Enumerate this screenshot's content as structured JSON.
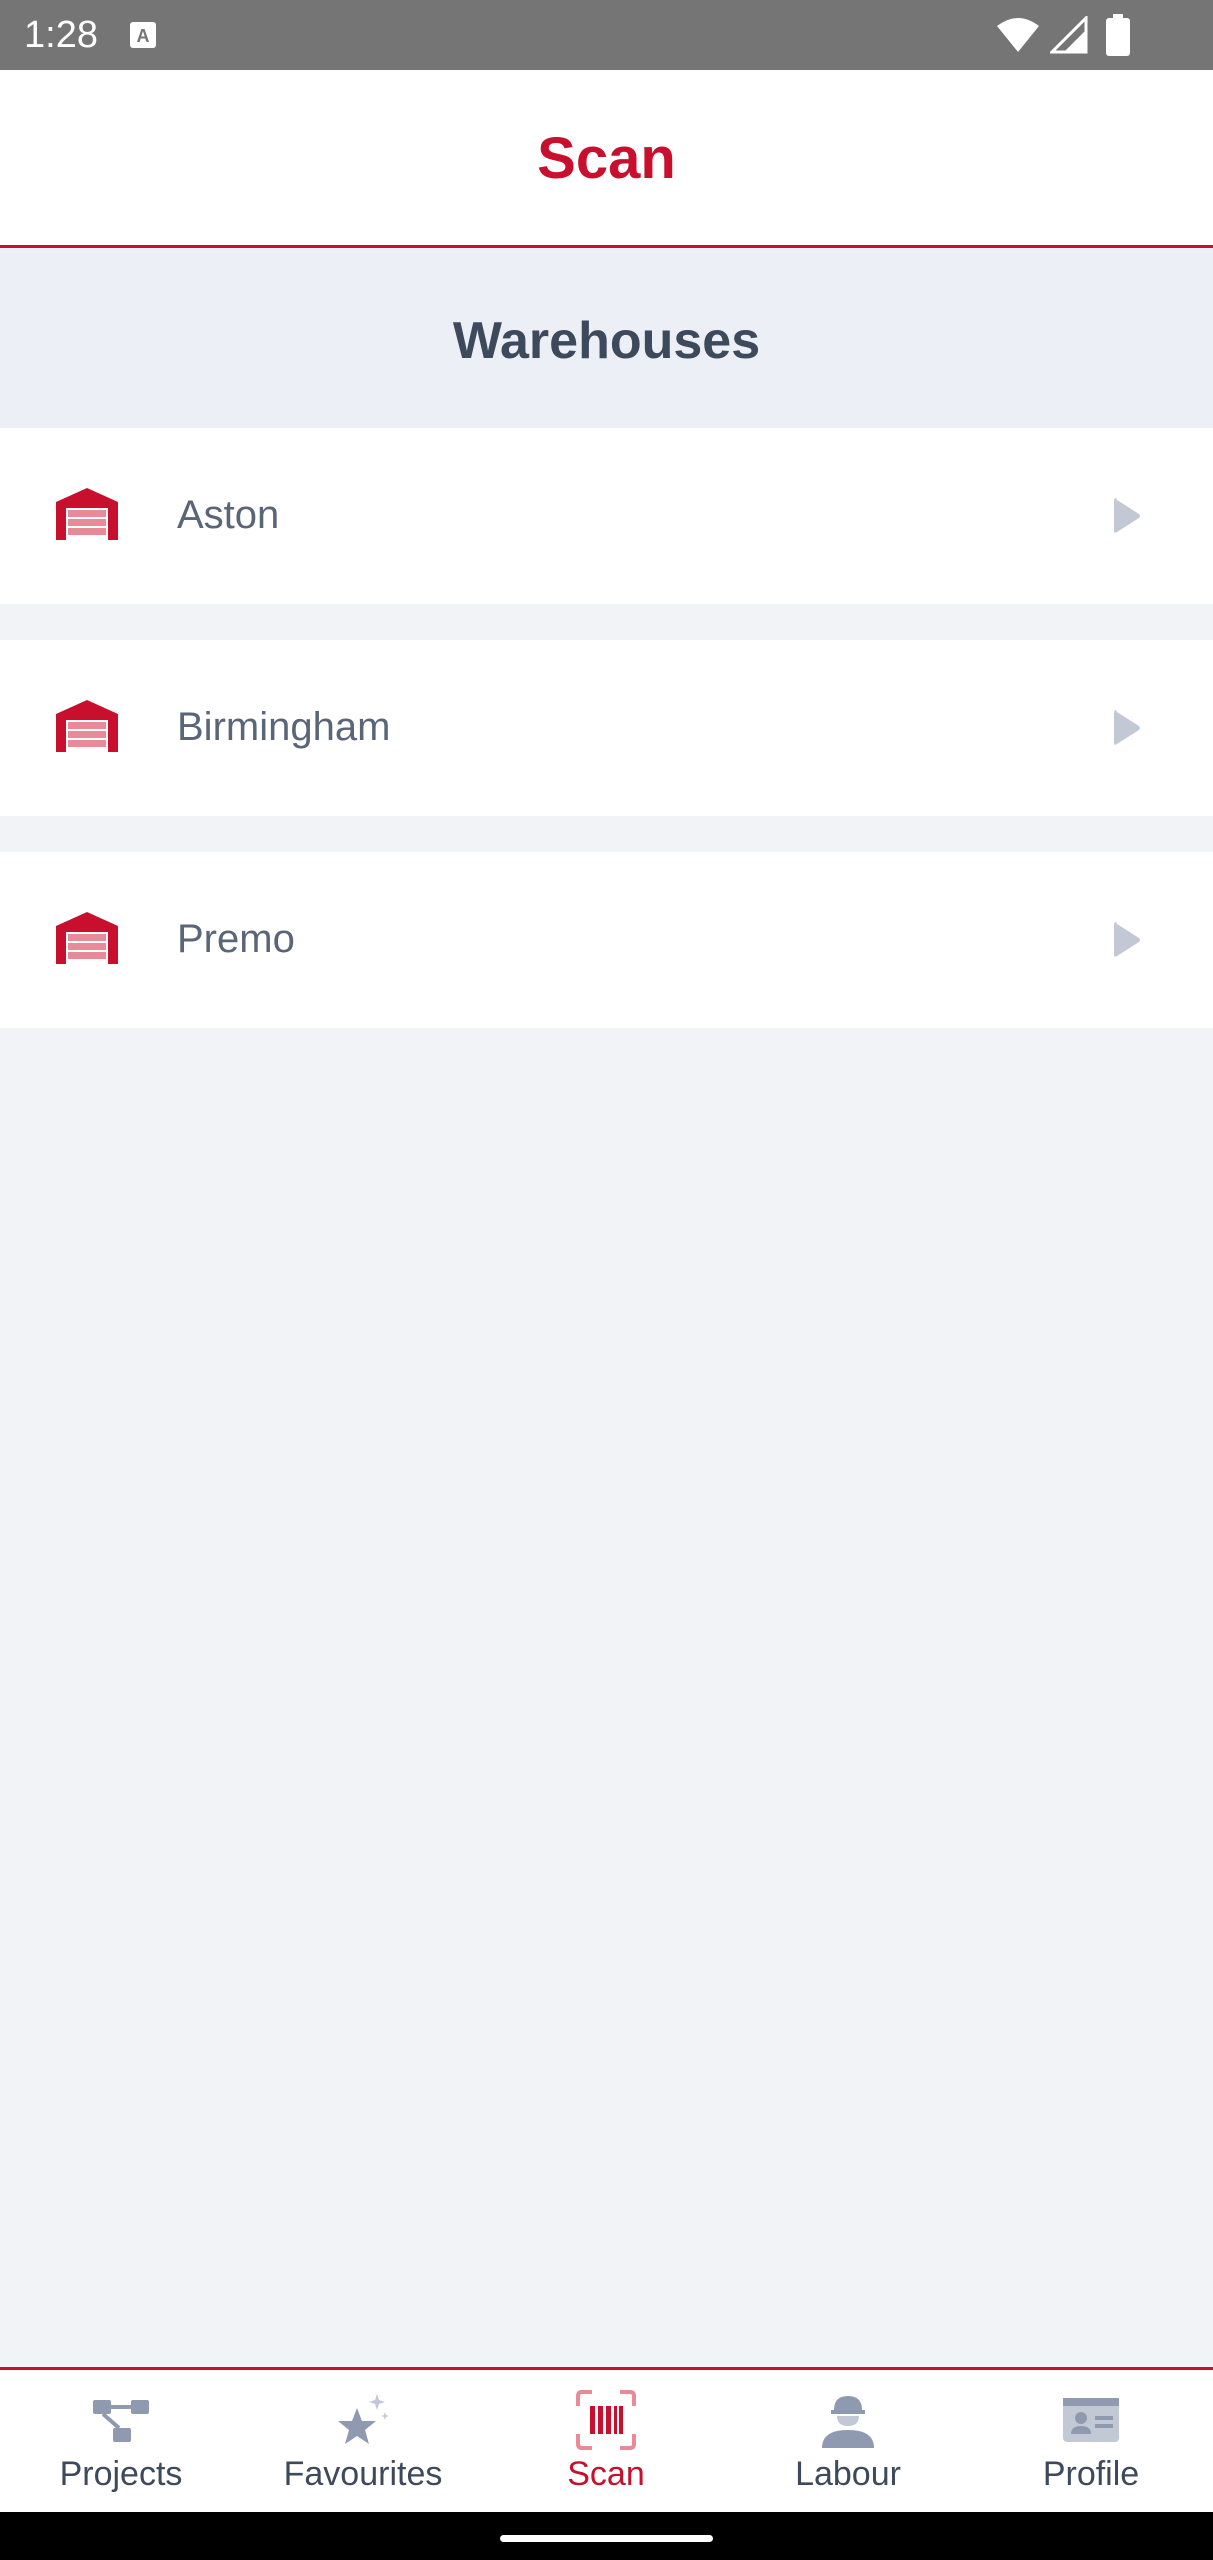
{
  "status_bar": {
    "time": "1:28",
    "icons": [
      "notification-a-icon",
      "wifi-icon",
      "signal-icon",
      "battery-icon"
    ]
  },
  "header": {
    "title": "Scan"
  },
  "section": {
    "title": "Warehouses"
  },
  "warehouses": [
    {
      "name": "Aston",
      "icon": "warehouse-icon"
    },
    {
      "name": "Birmingham",
      "icon": "warehouse-icon"
    },
    {
      "name": "Premo",
      "icon": "warehouse-icon"
    }
  ],
  "bottom_nav": {
    "active": "Scan",
    "items": [
      {
        "label": "Projects",
        "icon": "projects-icon"
      },
      {
        "label": "Favourites",
        "icon": "favourites-star-icon"
      },
      {
        "label": "Scan",
        "icon": "barcode-scan-icon"
      },
      {
        "label": "Labour",
        "icon": "worker-hardhat-icon"
      },
      {
        "label": "Profile",
        "icon": "profile-card-icon"
      }
    ]
  },
  "colors": {
    "brand_red": "#c8102e",
    "text_dark": "#3d4a5c",
    "text_muted": "#5a6577",
    "icon_gray": "#8f9ab0",
    "background": "#f1f3f6",
    "section_bg": "#eceff6"
  }
}
